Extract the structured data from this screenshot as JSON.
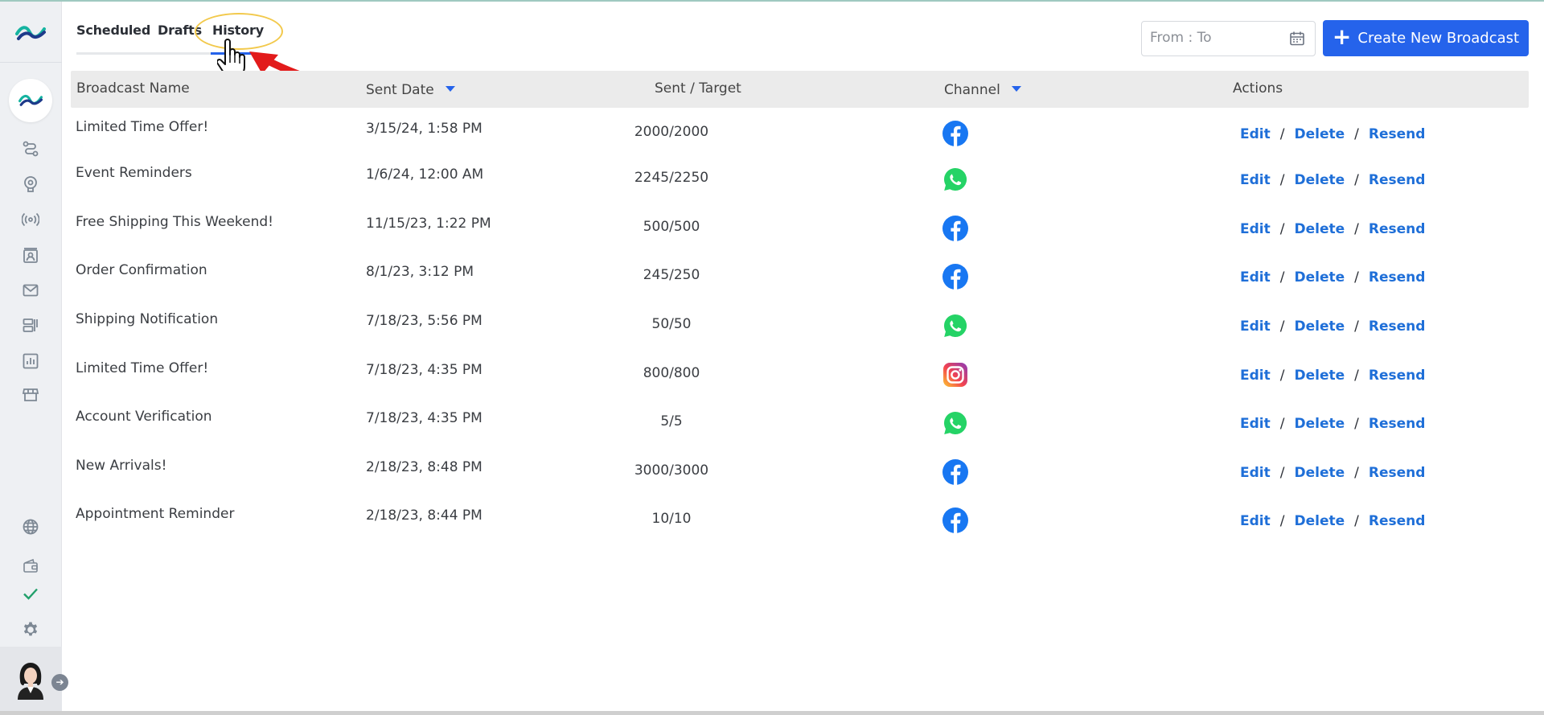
{
  "tabs": [
    {
      "label": "Scheduled"
    },
    {
      "label": "Drafts"
    },
    {
      "label": "History",
      "active": true
    }
  ],
  "date_range": {
    "placeholder": "From : To"
  },
  "create_button": {
    "label": "Create New Broadcast"
  },
  "columns": {
    "name": "Broadcast Name",
    "sent_date": "Sent Date",
    "sent_target": "Sent / Target",
    "channel": "Channel",
    "actions": "Actions"
  },
  "action_labels": {
    "edit": "Edit",
    "delete": "Delete",
    "resend": "Resend",
    "separator": "/"
  },
  "rows": [
    {
      "name": "Limited Time Offer!",
      "date": "3/15/24, 1:58 PM",
      "sent": "2000/2000",
      "channel": "facebook"
    },
    {
      "name": "Event Reminders",
      "date": "1/6/24, 12:00 AM",
      "sent": "2245/2250",
      "channel": "whatsapp"
    },
    {
      "name": "Free Shipping This Weekend!",
      "date": "11/15/23, 1:22 PM",
      "sent": "500/500",
      "channel": "facebook"
    },
    {
      "name": "Order Confirmation",
      "date": "8/1/23, 3:12 PM",
      "sent": "245/250",
      "channel": "facebook"
    },
    {
      "name": "Shipping Notification",
      "date": "7/18/23, 5:56 PM",
      "sent": "50/50",
      "channel": "whatsapp"
    },
    {
      "name": "Limited Time Offer!",
      "date": "7/18/23, 4:35 PM",
      "sent": "800/800",
      "channel": "instagram"
    },
    {
      "name": "Account Verification",
      "date": "7/18/23, 4:35 PM",
      "sent": "5/5",
      "channel": "whatsapp"
    },
    {
      "name": "New Arrivals!",
      "date": "2/18/23, 8:48 PM",
      "sent": "3000/3000",
      "channel": "facebook"
    },
    {
      "name": "Appointment Reminder",
      "date": "2/18/23, 8:44 PM",
      "sent": "10/10",
      "channel": "facebook"
    }
  ],
  "colors": {
    "accent": "#2563eb",
    "link": "#1f6fd8",
    "check": "#22a06b"
  }
}
